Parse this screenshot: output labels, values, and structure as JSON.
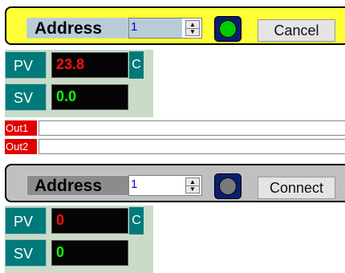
{
  "controller1": {
    "address_label": "Address",
    "address_value": "1",
    "status_led_color": "#00cc00",
    "action_button_label": "Cancel",
    "pv_label": "PV",
    "pv_value": "23.8",
    "pv_unit": "C",
    "sv_label": "SV",
    "sv_value": "0.0"
  },
  "outputs": [
    {
      "label": "Out1"
    },
    {
      "label": "Out2"
    }
  ],
  "controller2": {
    "address_label": "Address",
    "address_value": "1",
    "status_led_color": "#7a7a7a",
    "action_button_label": "Connect",
    "pv_label": "PV",
    "pv_value": "0",
    "pv_unit": "C",
    "sv_label": "SV",
    "sv_value": "0"
  },
  "colors": {
    "active_header": "#ffff38",
    "inactive_header": "#c0c0c0",
    "label_teal": "#007a7a",
    "pv_red": "#ff1010",
    "sv_green": "#10ff10",
    "output_red": "#e00000"
  },
  "icons": {
    "spinner": "up-down-spinner-icon",
    "status": "status-led-icon"
  }
}
